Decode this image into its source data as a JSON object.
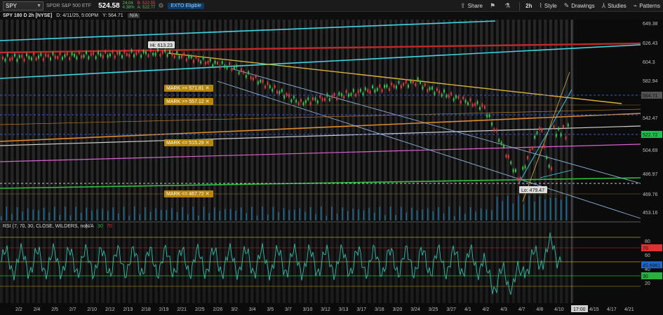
{
  "toolbar": {
    "symbol": "SPY",
    "description": "SPDR S&P 500 ETF",
    "price": "524.58",
    "change_top": "24.04",
    "change_pct": "4.38%",
    "bid": "B: 522.55",
    "ask": "A: 522.77",
    "ext_label": "EXTO Eligible",
    "share_label": "Share",
    "interval_label": "2h",
    "style_label": "Style",
    "drawings_label": "Drawings",
    "studies_label": "Studies",
    "patterns_label": "Patterns"
  },
  "subhead": {
    "title": "SPY 180 D 2h [NYSE]",
    "date": "D: 4/11/25, 5:00PM",
    "y_value": "Y: 564.71",
    "na": "N/A"
  },
  "price_axis": {
    "ticks": [
      "649.38",
      "626.43",
      "604.3",
      "582.94",
      "542.47",
      "504.69",
      "486.97",
      "469.76",
      "453.16"
    ],
    "badges": [
      {
        "label": "564.71",
        "color": "#555555"
      },
      {
        "label": "522.72",
        "color": "#1fbf4f"
      }
    ]
  },
  "annotations": {
    "hi": "Hi: 613.23",
    "lo": "Lo: 479.47",
    "marks": [
      "MARK >= 571.81",
      "MARK >= 557.12",
      "MARK <= 515.29",
      "MARK <= 467.72"
    ]
  },
  "rsi": {
    "label": "RSI (7, 70, 30, CLOSE, WILDERS, no)",
    "na": "N/A",
    "oversold": "30",
    "overbought": "70",
    "axis_ticks": [
      "80",
      "60",
      "40",
      "20"
    ],
    "badges": [
      {
        "label": "70",
        "color": "#e03030"
      },
      {
        "label": "45.6961",
        "color": "#1a6ad0"
      },
      {
        "label": "30",
        "color": "#2ab040"
      }
    ]
  },
  "time_axis": {
    "labels": [
      "2/2",
      "2/4",
      "2/5",
      "2/7",
      "2/10",
      "2/12",
      "2/13",
      "2/18",
      "2/19",
      "2/21",
      "2/25",
      "2/26",
      "3/2",
      "3/4",
      "3/5",
      "3/7",
      "3/10",
      "3/12",
      "3/13",
      "3/17",
      "3/18",
      "3/20",
      "3/24",
      "3/25",
      "3/27",
      "4/1",
      "4/2",
      "4/3",
      "4/7",
      "4/8",
      "4/10",
      "4/15",
      "4/17",
      "4/21"
    ],
    "current": "17:00"
  },
  "colors": {
    "cyan_channel": "#3fd6e6",
    "red_line": "#c0282a",
    "yellow_line": "#d9b23a",
    "orange_line": "#e08a2a",
    "white_line": "#cfcfcf",
    "magenta_line": "#e060d0",
    "green_line": "#2fc040",
    "blue_dashed": "#3a5ae0",
    "mark_badge": "#b8860b",
    "rsi_line": "#2bbfa8"
  }
}
